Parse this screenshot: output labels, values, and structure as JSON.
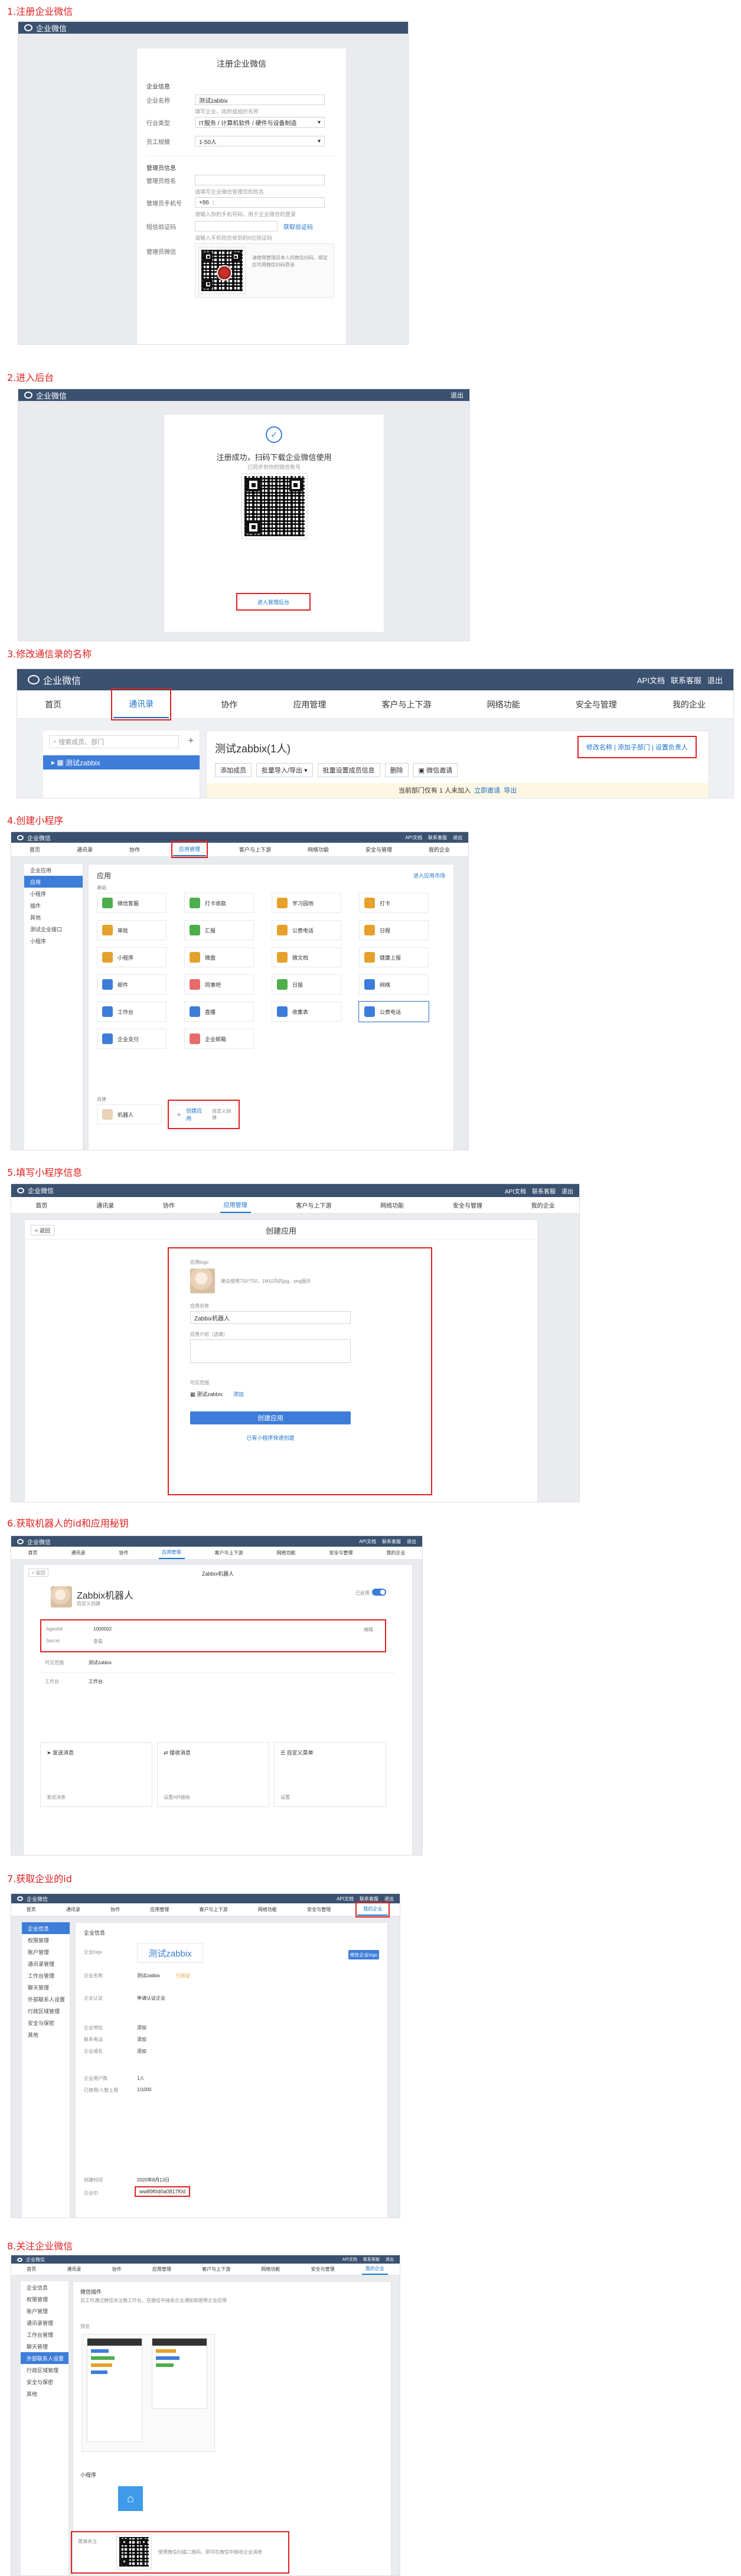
{
  "steps": [
    "1.注册企业微信",
    "2.进入后台",
    "3.修改通信录的名称",
    "4.创建小程序",
    "5.填写小程序信息",
    "6.获取机器人的id和应用秘钥",
    "7.获取企业的id",
    "8.关注企业微信"
  ],
  "common": {
    "brand": "企业微信",
    "api_doc": "API文档",
    "contact": "联系客服",
    "logout": "退出",
    "nav": [
      "首页",
      "通讯录",
      "协作",
      "应用管理",
      "客户与上下游",
      "网络功能",
      "安全与管理",
      "我的企业"
    ]
  },
  "step1": {
    "header": "注册企业微信",
    "section_company": "企业信息",
    "company_name_label": "企业名称",
    "company_name_value": "测试zabbix",
    "company_name_hint": "填写企业、政府或组织名称",
    "industry_label": "行业类型",
    "industry_value": "IT服务 / 计算机软件 / 硬件与设备制造",
    "scale_label": "员工规模",
    "scale_value": "1-50人",
    "section_admin": "管理员信息",
    "admin_name_label": "管理员姓名",
    "admin_name_hint": "请填写企业微信管理员的姓名",
    "admin_phone_label": "管理员手机号",
    "admin_phone_prefix": "+86",
    "admin_phone_hint": "请输入你的手机号码，用于企业微信的登录",
    "sms_label": "短信验证码",
    "sms_link": "获取验证码",
    "sms_hint": "请输入手机短信收到的6位验证码",
    "wechat_label": "管理员微信",
    "wechat_hint": "请使用管理员本人的微信扫码，绑定后可用微信扫码登录"
  },
  "step2": {
    "success_title": "注册成功，扫码下载企业微信使用",
    "success_sub": "已同步到你的微信账号",
    "enter_admin": "进入管理后台"
  },
  "step3": {
    "search_placeholder": "搜索成员、部门",
    "org_name": "测试zabbix",
    "dept_title": "测试zabbix(1人)",
    "edit_link": "修改名称 | 添加子部门 | 设置负责人",
    "toolbar": [
      "添加成员",
      "批量导入/导出",
      "批量设置成员信息",
      "删除",
      "微信邀请"
    ],
    "notice": "当前部门仅有 1 人未加入",
    "notice_link": "立即邀请",
    "notice_tail": "导出"
  },
  "step4": {
    "sidebar": [
      "企业应用",
      "应用",
      "小程序",
      "插件",
      "其他",
      "测试企业接口",
      "小程序"
    ],
    "page_title": "应用",
    "breadcrumb": "进入应用市场",
    "section_base": "基础",
    "apps": [
      "微信客服",
      "打卡收款",
      "学习园地",
      "打卡",
      "审批",
      "汇报",
      "公费电话",
      "日程",
      "小程序",
      "微盘",
      "微文档",
      "健康上报",
      "邮件",
      "同事吧",
      "日报",
      "网络",
      "工作台",
      "直播",
      "收集表",
      "公费电话",
      "企业支付",
      "企业邮箱"
    ],
    "section_custom": "自建",
    "robot_label": "机器人",
    "create_app": "创建应用",
    "create_app_sub": "自定义创建"
  },
  "step5": {
    "back": "< 返回",
    "title": "创建应用",
    "logo_label": "应用logo",
    "logo_hint": "建议使用750*750，1M以内的jpg、png图片",
    "name_label": "应用名称",
    "name_value": "Zabbix机器人",
    "desc_label": "应用介绍（选填）",
    "visible_label": "可见范围",
    "visible_value": "测试zabbix",
    "visible_edit": "添加",
    "create_btn": "创建应用",
    "mini_link": "已有小程序快速创建"
  },
  "step6": {
    "back": "< 返回",
    "title": "Zabbix机器人",
    "app_name": "Zabbix机器人",
    "app_sub": "自定义创建",
    "enable_label": "已启用",
    "agentid_label": "AgentId",
    "agentid_value": "1000002",
    "secret_label": "Secret",
    "secret_link": "查看",
    "edit_link": "编辑",
    "visible_label": "可见范围",
    "visible_value": "测试zabbix",
    "work_label": "工作台",
    "work_value": "工作台",
    "sections": [
      "发送消息",
      "接收消息",
      "自定义菜单"
    ],
    "send_link": "发送消息",
    "receive_link": "设置API接收",
    "menu_link": "设置"
  },
  "step7": {
    "sidebar": [
      "企业信息",
      "权限管理",
      "账户管理",
      "通讯录管理",
      "工作台管理",
      "聊天管理",
      "外部联系人设置",
      "行政区域管理",
      "安全与保密",
      "其他"
    ],
    "section_title": "企业信息",
    "logo_label": "企业logo",
    "logo_text": "测试zabbix",
    "logo_btn": "修改企业logo",
    "name_label": "企业名称",
    "name_value": "测试zabbix",
    "name_badge": "已验证",
    "auth_label": "企业认证",
    "auth_value": "申请认证企业",
    "address_label": "企业地址",
    "address_value": "添加",
    "phone_label": "联系电话",
    "phone_value": "添加",
    "domain_label": "企业域名",
    "domain_value": "添加",
    "people_label": "企业用户数",
    "people_value": "1人",
    "dept_label": "已使用/人数上限",
    "dept_value": "1/1000",
    "created_label": "创建时间",
    "created_value": "2020年8月13日",
    "id_label": "企业ID",
    "id_value": "ww89f0d0a0817f0d"
  },
  "step8": {
    "sidebar": [
      "企业信息",
      "权限管理",
      "账户管理",
      "通讯录管理",
      "工作台管理",
      "聊天管理",
      "外部联系人设置",
      "行政区域管理",
      "安全与保密",
      "其他"
    ],
    "section_title": "微信插件",
    "section_sub": "员工可通过微信关注微工作台，在微信中接收企业通知和使用企业应用",
    "preview_label": "预览",
    "plugin_title": "小程序",
    "follow_label": "邀请关注",
    "follow_hint": "使用微信扫描二维码，即可在微信中接收企业消息"
  }
}
